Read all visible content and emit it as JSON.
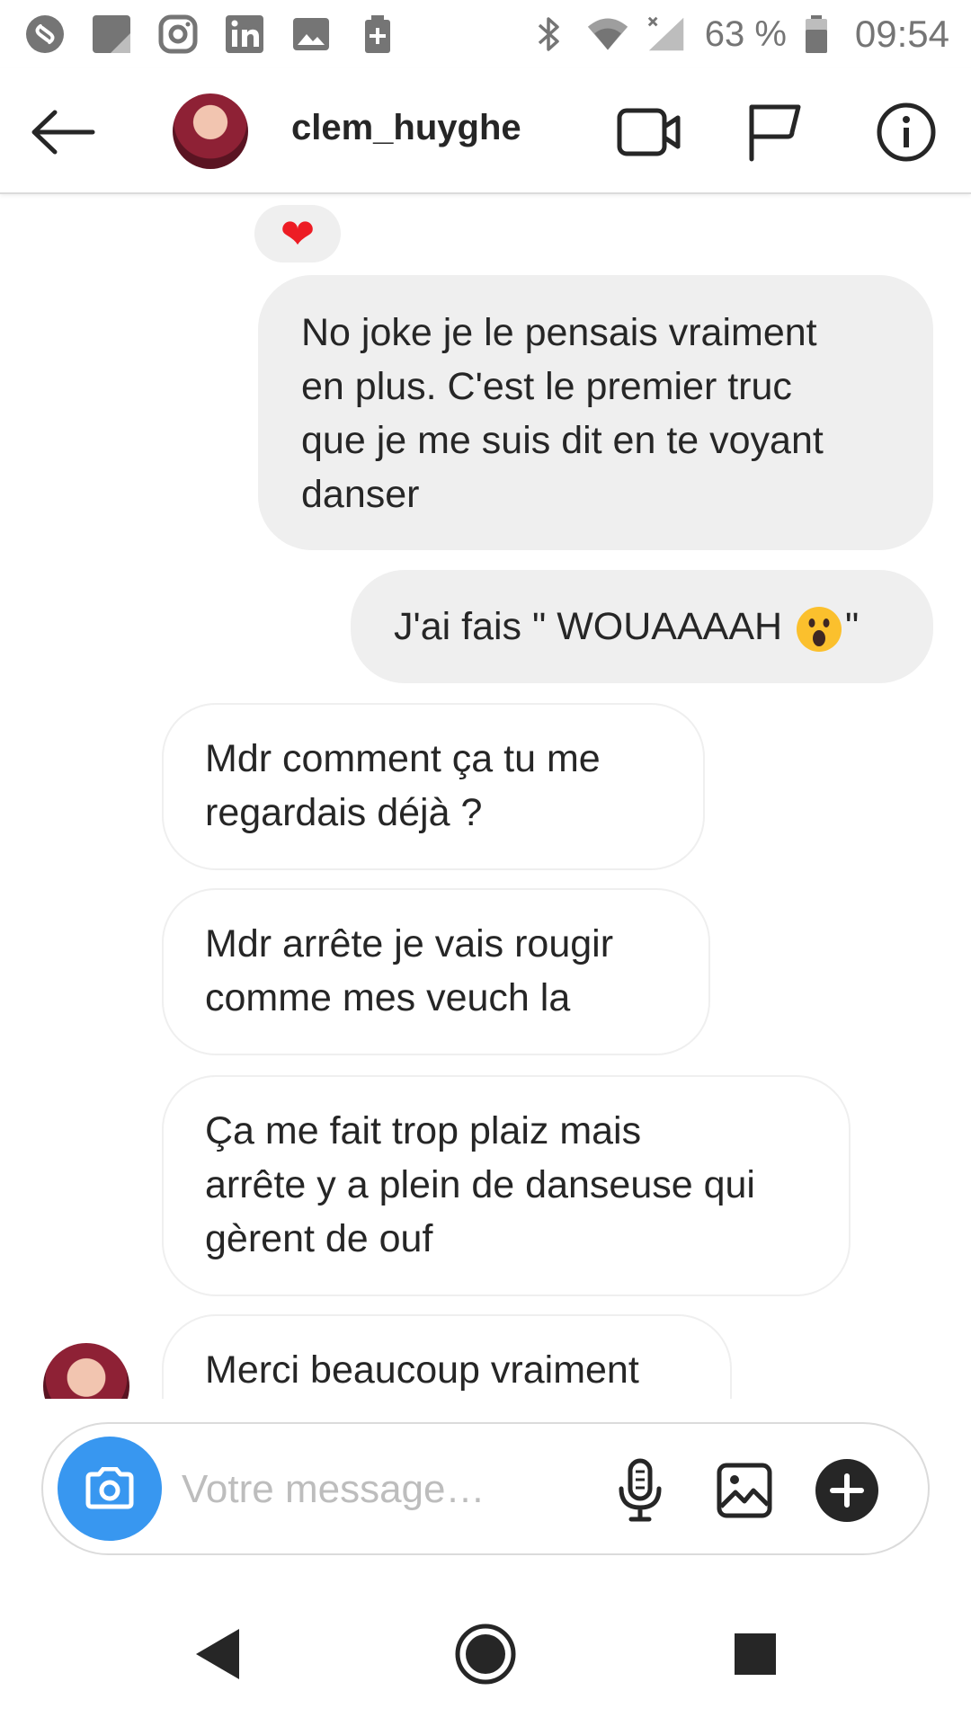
{
  "status_bar": {
    "left_icons": [
      "shazam-icon",
      "notes-app-icon",
      "instagram-icon",
      "linkedin-icon",
      "gallery-icon",
      "battery-saver-icon"
    ],
    "right_icons": [
      "bluetooth-icon",
      "wifi-icon",
      "cellular-signal-icon",
      "battery-icon"
    ],
    "battery_percent": "63 %",
    "time": "09:54"
  },
  "header": {
    "username": "clem_huyghe",
    "actions": [
      "video-call-icon",
      "flag-icon",
      "info-icon"
    ]
  },
  "conversation": {
    "reaction": "❤",
    "messages": [
      {
        "from": "me",
        "lines": [
          "No joke je le pensais vraiment",
          "en plus. C'est le premier truc",
          "que je me suis dit en te voyant",
          "danser"
        ]
      },
      {
        "from": "me",
        "text_before": "J'ai fais \" WOUAAAAH ",
        "emoji": "astonished-face",
        "text_after": "\""
      },
      {
        "from": "them",
        "lines": [
          "Mdr comment ça tu me",
          "regardais déjà ?"
        ]
      },
      {
        "from": "them",
        "lines": [
          "Mdr arrête je vais rougir",
          "comme mes veuch la"
        ]
      },
      {
        "from": "them",
        "lines": [
          "Ça me fait trop plaiz mais",
          "arrête y a plein de danseuse qui",
          "gèrent de ouf"
        ]
      },
      {
        "from": "them",
        "lines": [
          "Merci beaucoup vraiment"
        ]
      }
    ]
  },
  "composer": {
    "placeholder": "Votre message…",
    "value": "",
    "icons": [
      "camera-icon",
      "microphone-icon",
      "image-icon",
      "plus-icon"
    ]
  },
  "colors": {
    "accent_blue": "#3897f0",
    "sent_bubble": "#efefef",
    "heart_red": "#ed1c24",
    "text": "#262626",
    "placeholder": "#bdbdbd"
  }
}
